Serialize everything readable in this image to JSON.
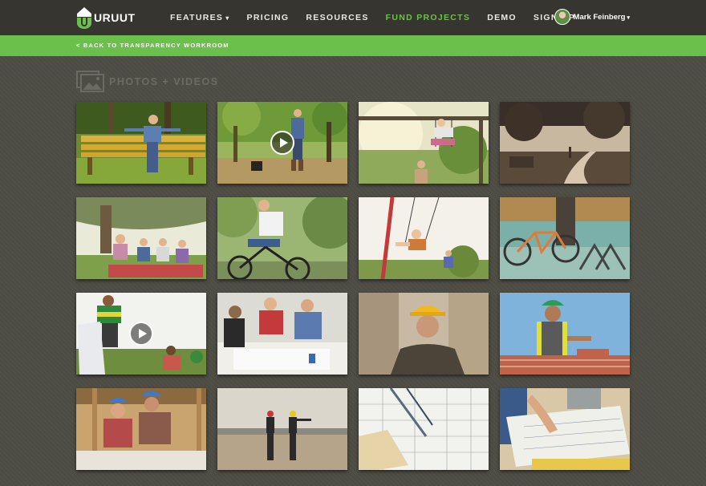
{
  "header": {
    "logo_text": "URUUT",
    "nav": [
      {
        "label": "FEATURES",
        "dropdown": true,
        "active": false
      },
      {
        "label": "PRICING",
        "dropdown": false,
        "active": false
      },
      {
        "label": "RESOURCES",
        "dropdown": false,
        "active": false
      },
      {
        "label": "FUND PROJECTS",
        "dropdown": false,
        "active": true
      },
      {
        "label": "DEMO",
        "dropdown": false,
        "active": false
      },
      {
        "label": "SIGN UP",
        "dropdown": false,
        "active": false
      }
    ],
    "user": {
      "name": "Mark Feinberg",
      "caret": "▾"
    },
    "caret": "▾"
  },
  "subheader": {
    "back_link": "< BACK TO TRANSPARENCY WORKROOM"
  },
  "section": {
    "title": "PHOTOS + VIDEOS",
    "icon": "photo-gallery-icon"
  },
  "colors": {
    "accent_green": "#6bc04b",
    "topbar": "#37352f",
    "background": "#4e4d45"
  },
  "media": [
    {
      "name": "boy-on-park-bench",
      "type": "photo"
    },
    {
      "name": "woman-walking-dog",
      "type": "video"
    },
    {
      "name": "child-on-swing-with-mother",
      "type": "photo"
    },
    {
      "name": "park-path-at-dusk",
      "type": "photo"
    },
    {
      "name": "family-picnic-under-tree",
      "type": "photo"
    },
    {
      "name": "man-riding-bicycle",
      "type": "photo"
    },
    {
      "name": "girl-on-swing-playground",
      "type": "photo"
    },
    {
      "name": "bicycle-at-rack",
      "type": "photo"
    },
    {
      "name": "volunteers-collecting-trash",
      "type": "video"
    },
    {
      "name": "team-reviewing-plans",
      "type": "photo"
    },
    {
      "name": "construction-worker-hard-hat",
      "type": "photo"
    },
    {
      "name": "bricklayer-at-wall",
      "type": "photo"
    },
    {
      "name": "builders-at-workbench",
      "type": "photo"
    },
    {
      "name": "engineers-on-site",
      "type": "photo"
    },
    {
      "name": "blueprints-with-tools",
      "type": "photo"
    },
    {
      "name": "hands-on-blueprints",
      "type": "photo"
    }
  ]
}
